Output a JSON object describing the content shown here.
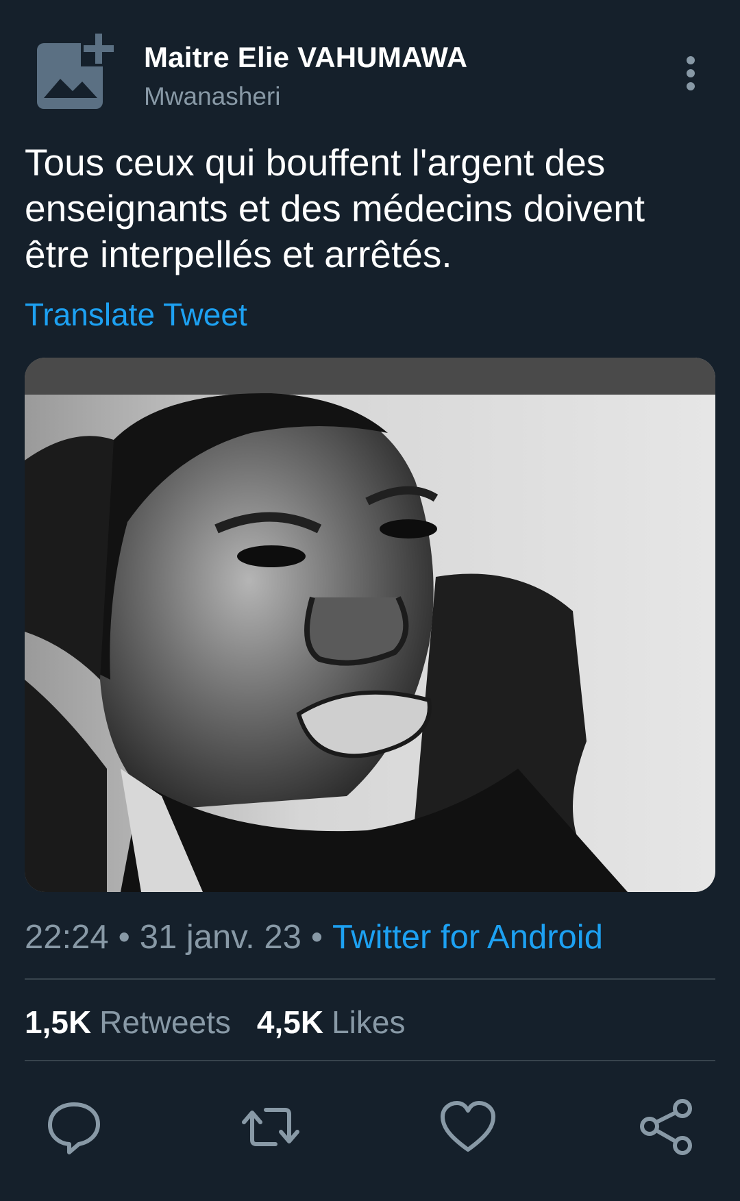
{
  "author": {
    "name": "Maitre Elie VAHUMAWA",
    "handle": "Mwanasheri",
    "avatar_icon": "add-image-icon"
  },
  "tweet": {
    "text": "Tous ceux qui bouffent l'argent des enseignants et des médecins doivent être interpellés et arrêtés.",
    "translate_label": "Translate Tweet",
    "media_description_icon": "photo"
  },
  "meta": {
    "time": "22:24",
    "date": "31 janv. 23",
    "separator": "•",
    "source": "Twitter for Android"
  },
  "stats": {
    "retweets_count": "1,5K",
    "retweets_label": "Retweets",
    "likes_count": "4,5K",
    "likes_label": "Likes"
  },
  "actions": [
    {
      "name": "reply",
      "icon": "reply-icon"
    },
    {
      "name": "retweet",
      "icon": "retweet-icon"
    },
    {
      "name": "like",
      "icon": "heart-icon"
    },
    {
      "name": "share",
      "icon": "share-icon"
    }
  ],
  "colors": {
    "background": "#15202b",
    "accent": "#1da1f2",
    "secondary_text": "#8899a6",
    "divider": "#38444d"
  }
}
